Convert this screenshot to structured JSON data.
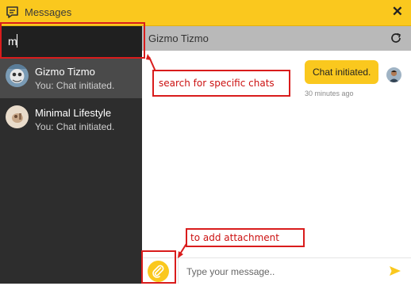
{
  "window": {
    "title": "Messages",
    "icon": "chat-bubble-icon",
    "close": "close-icon",
    "accent_color": "#fac81e"
  },
  "sidebar": {
    "search": {
      "value": "m",
      "placeholder": ""
    },
    "chats": [
      {
        "name": "Gizmo Tizmo",
        "preview": "You: Chat initiated.",
        "active": true,
        "avatar": "gizmo-avatar-icon"
      },
      {
        "name": "Minimal Lifestyle",
        "preview": "You: Chat initiated.",
        "active": false,
        "avatar": "minimal-lifestyle-avatar-icon"
      }
    ]
  },
  "conversation": {
    "header_name": "Gizmo Tizmo",
    "refresh_icon": "refresh-icon",
    "messages": [
      {
        "text": "Chat initiated.",
        "time": "30 minutes ago",
        "from": "me"
      }
    ]
  },
  "composer": {
    "placeholder": "Type your message..",
    "attach_icon": "paperclip-icon",
    "send_icon": "send-icon"
  },
  "annotations": {
    "search_note": "search for specific chats",
    "attach_note": "to add attachment",
    "annotation_color": "#d91c1c"
  }
}
